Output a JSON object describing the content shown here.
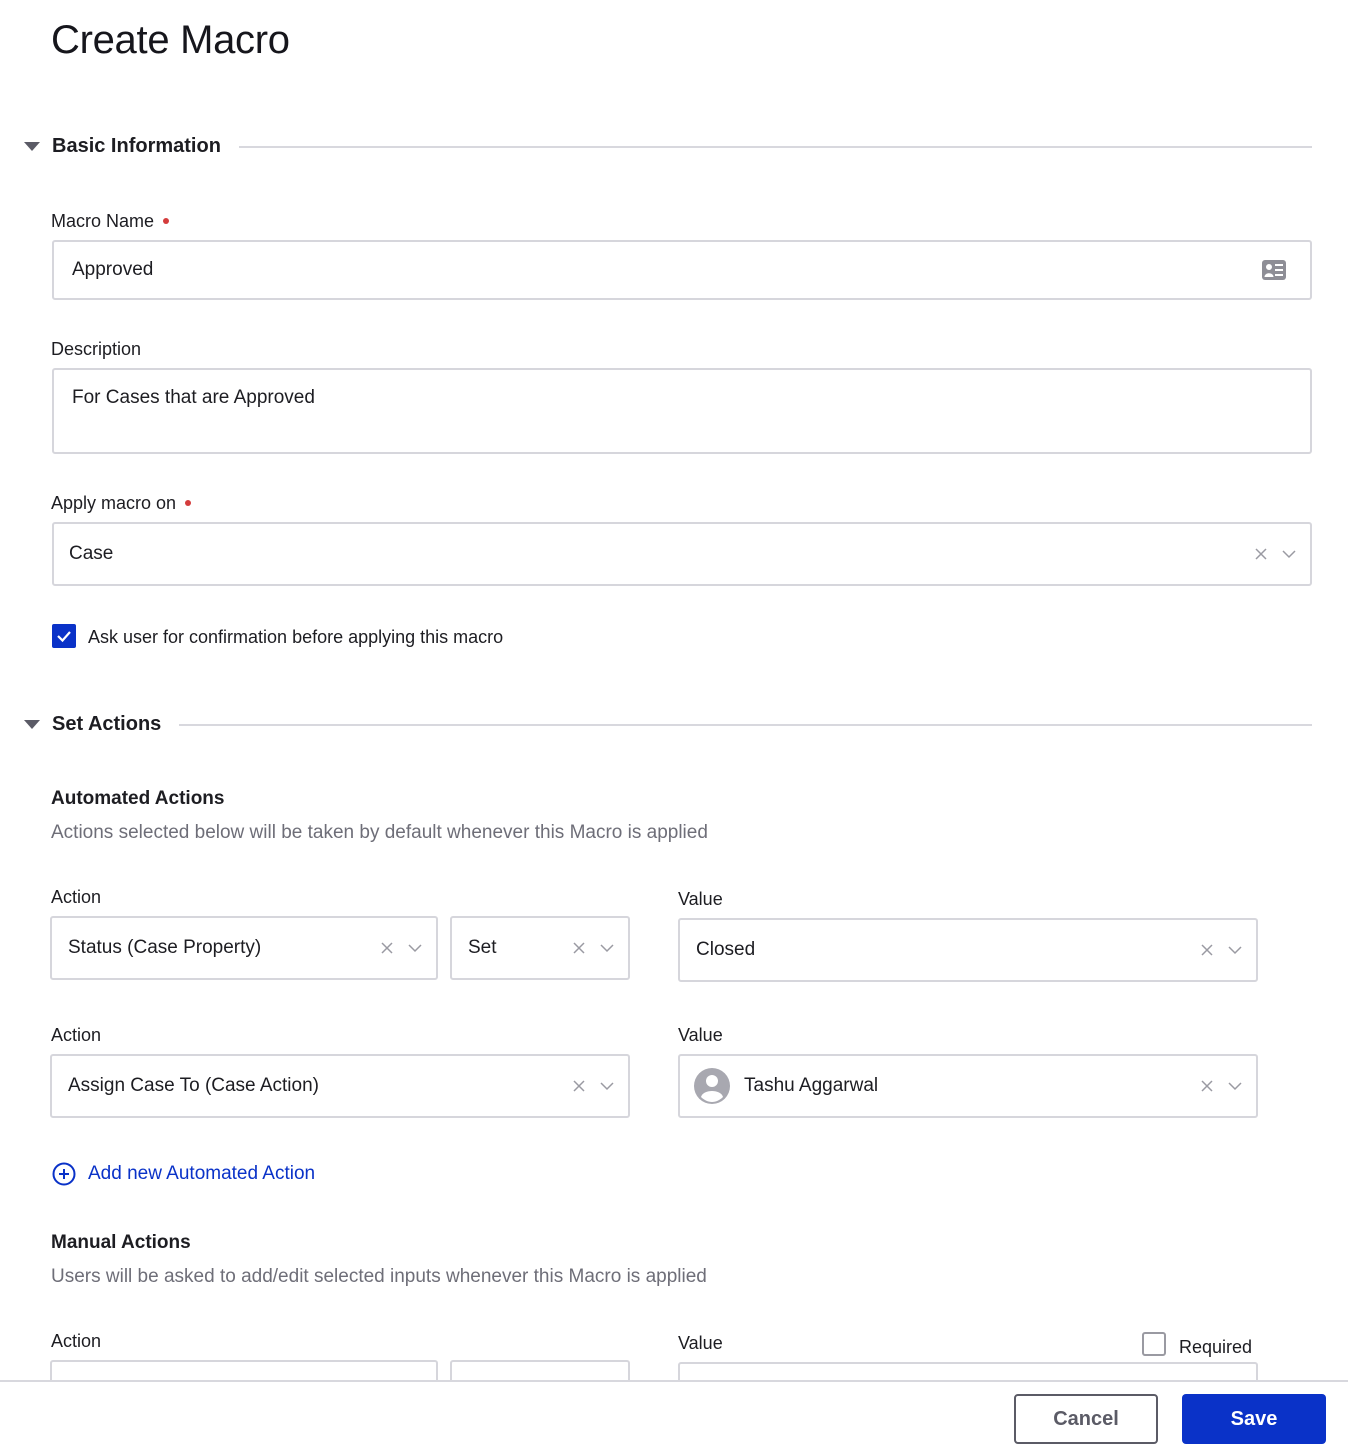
{
  "page": {
    "title": "Create Macro"
  },
  "basic_info": {
    "section_title": "Basic Information",
    "macro_name": {
      "label": "Macro Name",
      "required": true,
      "value": "Approved",
      "icon": "contact-card-icon"
    },
    "description": {
      "label": "Description",
      "value": "For Cases that are Approved"
    },
    "apply_on": {
      "label": "Apply macro on",
      "required": true,
      "value": "Case"
    },
    "confirmation": {
      "label": "Ask user for confirmation before applying this macro",
      "checked": true
    }
  },
  "set_actions": {
    "section_title": "Set Actions",
    "automated": {
      "title": "Automated Actions",
      "helper": "Actions selected below will be taken by default whenever this Macro is applied",
      "rows": [
        {
          "action_label": "Action",
          "action": "Status (Case Property)",
          "operator": "Set",
          "value_label": "Value",
          "value": "Closed"
        },
        {
          "action_label": "Action",
          "action": "Assign Case To (Case Action)",
          "value_label": "Value",
          "value": "Tashu Aggarwal",
          "value_icon": "user-avatar-icon"
        }
      ],
      "add_link": "Add new Automated Action"
    },
    "manual": {
      "title": "Manual Actions",
      "helper": "Users will be asked to add/edit selected inputs whenever this Macro is applied",
      "rows": [
        {
          "action_label": "Action",
          "action": "",
          "operator": "",
          "value_label": "Value",
          "value": "",
          "required_label": "Required",
          "required_checked": false
        }
      ]
    }
  },
  "footer": {
    "cancel_label": "Cancel",
    "save_label": "Save"
  },
  "colors": {
    "accent": "#0a32c8",
    "required_dot": "#d43c3c",
    "border": "#d6d6dc",
    "helper_text": "#6e6e78"
  }
}
